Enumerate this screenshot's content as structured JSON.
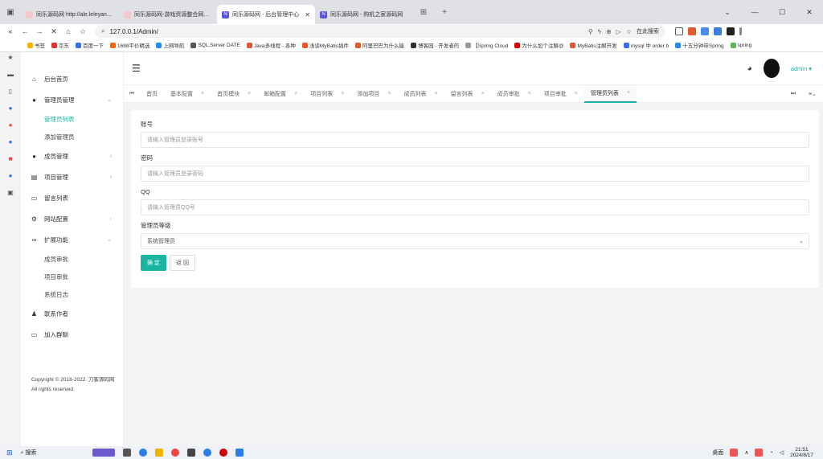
{
  "browser": {
    "tabs": [
      {
        "title": "同乐源码网 http://ale.leleyangya..."
      },
      {
        "title": "同乐源码网-游戏资源整合网站-..."
      },
      {
        "title": "同乐源码网 - 后台管理中心",
        "active": true
      },
      {
        "title": "同乐源码网 - 购机之家源码网"
      }
    ],
    "new_tab": "+",
    "url": "127.0.0.1/Admin/",
    "search_label": "在此搜索",
    "bookmarks": [
      "书签",
      "京东",
      "百度一下",
      "1688平价精选",
      "上网导航",
      "SQL Server DATE",
      "Java多线程 - 各种",
      "浅谈MyBatis插件",
      "阿里巴巴为什么能",
      "博客园 - 开发者的",
      "【Spring Cloud",
      "为什么加个注解@",
      "MyBatis注解开发",
      "mysql 中 order b",
      "十五分钟带Spring",
      "spring"
    ]
  },
  "sidebar": {
    "items": [
      {
        "label": "后台首页",
        "icon": "home-icon"
      },
      {
        "label": "管理员管理",
        "icon": "user-icon",
        "expanded": true
      },
      {
        "label": "成员管理",
        "icon": "user-icon"
      },
      {
        "label": "项目管理",
        "icon": "book-icon"
      },
      {
        "label": "留言列表",
        "icon": "chat-icon"
      },
      {
        "label": "网站配置",
        "icon": "gear-icon"
      },
      {
        "label": "扩展功能",
        "icon": "link-icon"
      },
      {
        "label": "联系作者",
        "icon": "contact-icon"
      },
      {
        "label": "加入群聊",
        "icon": "chat-icon"
      }
    ],
    "sub_admin": [
      "管理员列表",
      "添加管理员"
    ],
    "sub_ext": [
      "成员审批",
      "项目审批",
      "系统日志"
    ],
    "copyright": "Copyright © 2018-2022. 刀客源码网 All rights reserved."
  },
  "header": {
    "user": "admin",
    "user_caret": "▾"
  },
  "page_tabs": [
    "首页",
    "基本配置",
    "首页模块",
    "邮箱配置",
    "项目列表",
    "添加项目",
    "成员列表",
    "留言列表",
    "成员审批",
    "项目审批",
    "管理员列表"
  ],
  "form": {
    "account_label": "账号",
    "account_placeholder": "请输入管理员登录账号",
    "password_label": "密码",
    "password_placeholder": "请输入管理员登录密码",
    "qq_label": "QQ",
    "qq_placeholder": "请输入管理员QQ号",
    "level_label": "管理员等级",
    "level_value": "系统管理员",
    "submit": "确 定",
    "back": "返 回"
  },
  "taskbar": {
    "search": "搜索",
    "desktop": "桌面",
    "time": "21:51",
    "date": "2024/8/17"
  },
  "colors": {
    "accent": "#19b5a1"
  }
}
